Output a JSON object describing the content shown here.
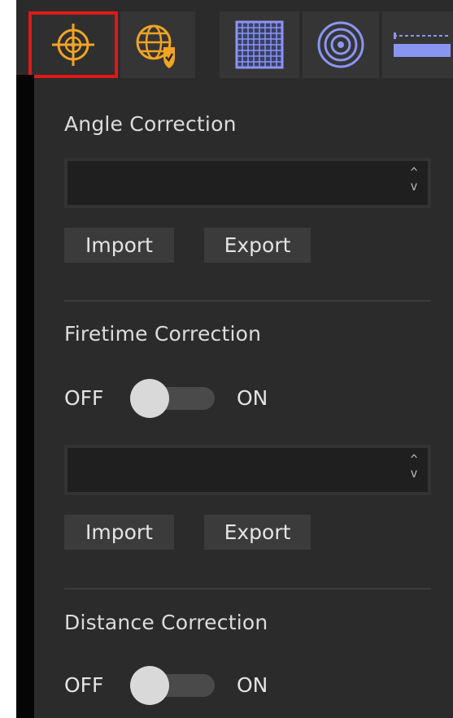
{
  "toolbar": {
    "tools": [
      {
        "name": "crosshair-target-icon",
        "active": true
      },
      {
        "name": "globe-shield-icon",
        "active": false
      },
      {
        "name": "grid-icon",
        "active": false
      },
      {
        "name": "concentric-rings-icon",
        "active": false
      },
      {
        "name": "ruler-icon",
        "active": false
      }
    ]
  },
  "colors": {
    "accent": "#f2a424",
    "active_border": "#e01818",
    "tool_blue": "#8a95f2"
  },
  "angle_correction": {
    "title": "Angle Correction",
    "file_value": "",
    "import_label": "Import",
    "export_label": "Export"
  },
  "firetime_correction": {
    "title": "Firetime Correction",
    "off_label": "OFF",
    "on_label": "ON",
    "enabled": false,
    "file_value": "",
    "import_label": "Import",
    "export_label": "Export"
  },
  "distance_correction": {
    "title": "Distance Correction",
    "off_label": "OFF",
    "on_label": "ON",
    "enabled": false
  },
  "spin": {
    "up": "^",
    "down": "v"
  }
}
